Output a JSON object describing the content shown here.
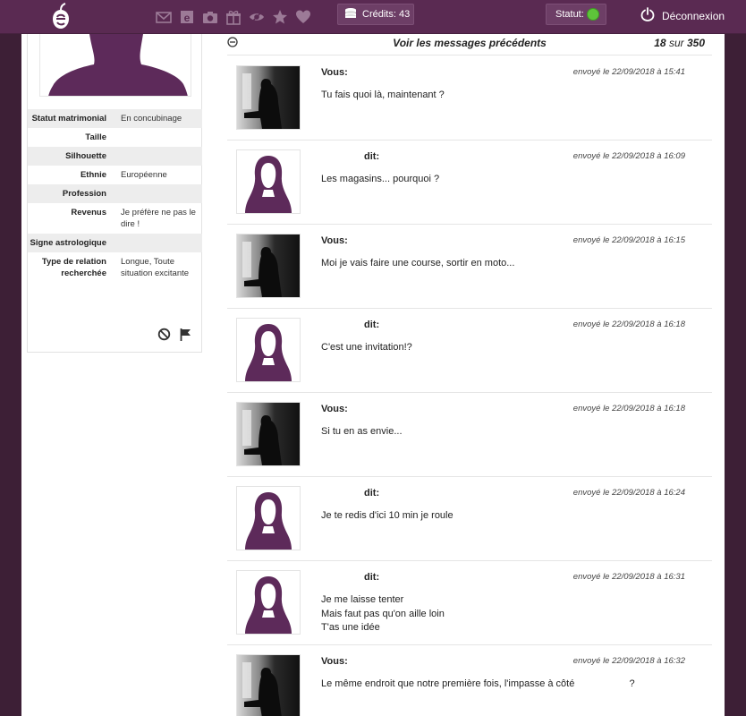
{
  "header": {
    "logo_icon": "e-apple-logo-icon",
    "nav_icons": [
      "mail-icon",
      "e-badge-icon",
      "camera-icon",
      "gift-icon",
      "eye-icon",
      "star-icon",
      "heart-icon"
    ],
    "credits_label": "Crédits: 43",
    "status_label": "Statut:",
    "logout_label": "Déconnexion"
  },
  "profile": {
    "attributes": [
      {
        "label": "Statut matrimonial",
        "value": "En concubinage"
      },
      {
        "label": "Taille",
        "value": ""
      },
      {
        "label": "Silhouette",
        "value": ""
      },
      {
        "label": "Ethnie",
        "value": "Européenne"
      },
      {
        "label": "Profession",
        "value": ""
      },
      {
        "label": "Revenus",
        "value": "Je préfère ne pas le dire !"
      },
      {
        "label": "Signe astrologique",
        "value": ""
      },
      {
        "label": "Type de relation recherchée",
        "value": "Longue, Toute situation excitante"
      }
    ]
  },
  "messages_header": {
    "prev_link": "Voir les messages précédents",
    "count_shown": "18",
    "count_sep": "sur",
    "count_total": "350"
  },
  "messages": [
    {
      "author": "Vous:",
      "date": "envoyé le 22/09/2018 à 15:41",
      "text": "Tu fais quoi là, maintenant ?",
      "avatar": "photo"
    },
    {
      "author": "dit:",
      "date": "envoyé le 22/09/2018 à 16:09",
      "text": "Les magasins... pourquoi ?",
      "avatar": "silhouette"
    },
    {
      "author": "Vous:",
      "date": "envoyé le 22/09/2018 à 16:15",
      "text": "Moi je vais faire une course, sortir en moto...",
      "avatar": "photo"
    },
    {
      "author": "dit:",
      "date": "envoyé le 22/09/2018 à 16:18",
      "text": "C'est une invitation!?",
      "avatar": "silhouette"
    },
    {
      "author": "Vous:",
      "date": "envoyé le 22/09/2018 à 16:18",
      "text": "Si tu en as envie...",
      "avatar": "photo"
    },
    {
      "author": "dit:",
      "date": "envoyé le 22/09/2018 à 16:24",
      "text": "Je te redis d'ici 10 min je roule",
      "avatar": "silhouette"
    },
    {
      "author": "dit:",
      "date": "envoyé le 22/09/2018 à 16:31",
      "text": "Je me laisse tenter\nMais faut pas qu'on aille loin\nT'as une idée",
      "avatar": "silhouette"
    },
    {
      "author": "Vous:",
      "date": "envoyé le 22/09/2018 à 16:32",
      "text": "Le même endroit que notre première fois, l'impasse à côté                    ?",
      "avatar": "photo"
    }
  ]
}
